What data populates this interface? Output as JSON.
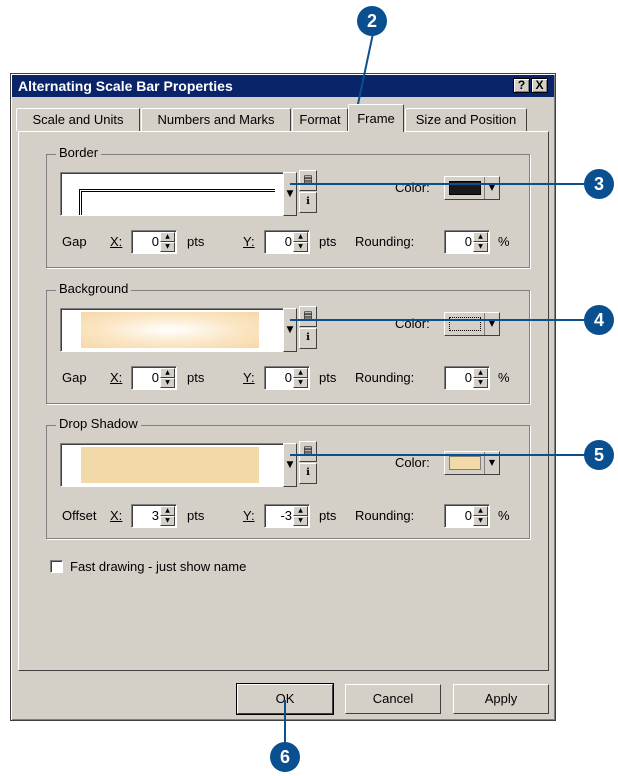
{
  "window": {
    "title": "Alternating Scale Bar Properties",
    "help_button": "?",
    "close_button": "X"
  },
  "tabs": [
    {
      "label": "Scale and Units"
    },
    {
      "label": "Numbers and Marks"
    },
    {
      "label": "Format"
    },
    {
      "label": "Frame",
      "active": true
    },
    {
      "label": "Size and Position"
    }
  ],
  "border": {
    "group_label": "Border",
    "color_label": "Color:",
    "color_value": "#1a1a1a",
    "gap_label": "Gap",
    "x_label": "X:",
    "x_value": "0",
    "y_label": "Y:",
    "y_value": "0",
    "units": "pts",
    "rounding_label": "Rounding:",
    "rounding_value": "0",
    "percent": "%"
  },
  "background": {
    "group_label": "Background",
    "color_label": "Color:",
    "color_value": "#f3d6a6",
    "gap_label": "Gap",
    "x_label": "X:",
    "x_value": "0",
    "y_label": "Y:",
    "y_value": "0",
    "units": "pts",
    "rounding_label": "Rounding:",
    "rounding_value": "0",
    "percent": "%"
  },
  "drop_shadow": {
    "group_label": "Drop Shadow",
    "color_label": "Color:",
    "color_value": "#f2daa8",
    "offset_label": "Offset",
    "x_label": "X:",
    "x_value": "3",
    "y_label": "Y:",
    "y_value": "-3",
    "units": "pts",
    "rounding_label": "Rounding:",
    "rounding_value": "0",
    "percent": "%"
  },
  "fast_drawing": {
    "label": "Fast drawing - just show name",
    "checked": false
  },
  "buttons": {
    "ok": "OK",
    "cancel": "Cancel",
    "apply": "Apply"
  },
  "callouts": {
    "c2": "2",
    "c3": "3",
    "c4": "4",
    "c5": "5",
    "c6": "6",
    "color": "#0a4f8f"
  }
}
